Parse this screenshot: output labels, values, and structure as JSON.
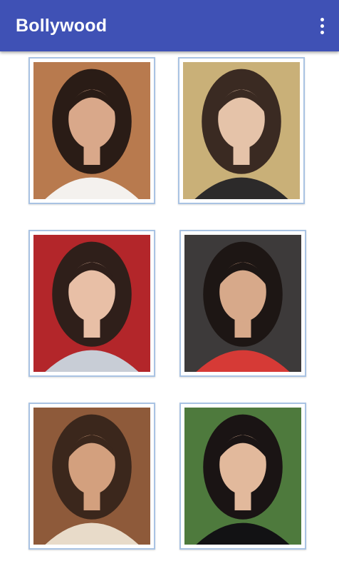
{
  "app_bar": {
    "title": "Bollywood",
    "menu_icon": "more-vert-icon"
  },
  "gallery": {
    "items": [
      {
        "bg": "#b87a4e",
        "skin": "#d9a88a",
        "hair": "#2a1c16",
        "cloth": "#f4f1ee"
      },
      {
        "bg": "#c9b078",
        "skin": "#e5c3a9",
        "hair": "#3a2a22",
        "cloth": "#2c2a2a"
      },
      {
        "bg": "#b3262a",
        "skin": "#e8bfa6",
        "hair": "#2f1f1a",
        "cloth": "#c8cdd6"
      },
      {
        "bg": "#3d3a3a",
        "skin": "#d7a98a",
        "hair": "#1d1614",
        "cloth": "#d63a36"
      },
      {
        "bg": "#8e5a3a",
        "skin": "#d3a07e",
        "hair": "#3b271c",
        "cloth": "#e8dbc9"
      },
      {
        "bg": "#4e7a3d",
        "skin": "#e2b99c",
        "hair": "#1a1414",
        "cloth": "#121214"
      }
    ]
  }
}
